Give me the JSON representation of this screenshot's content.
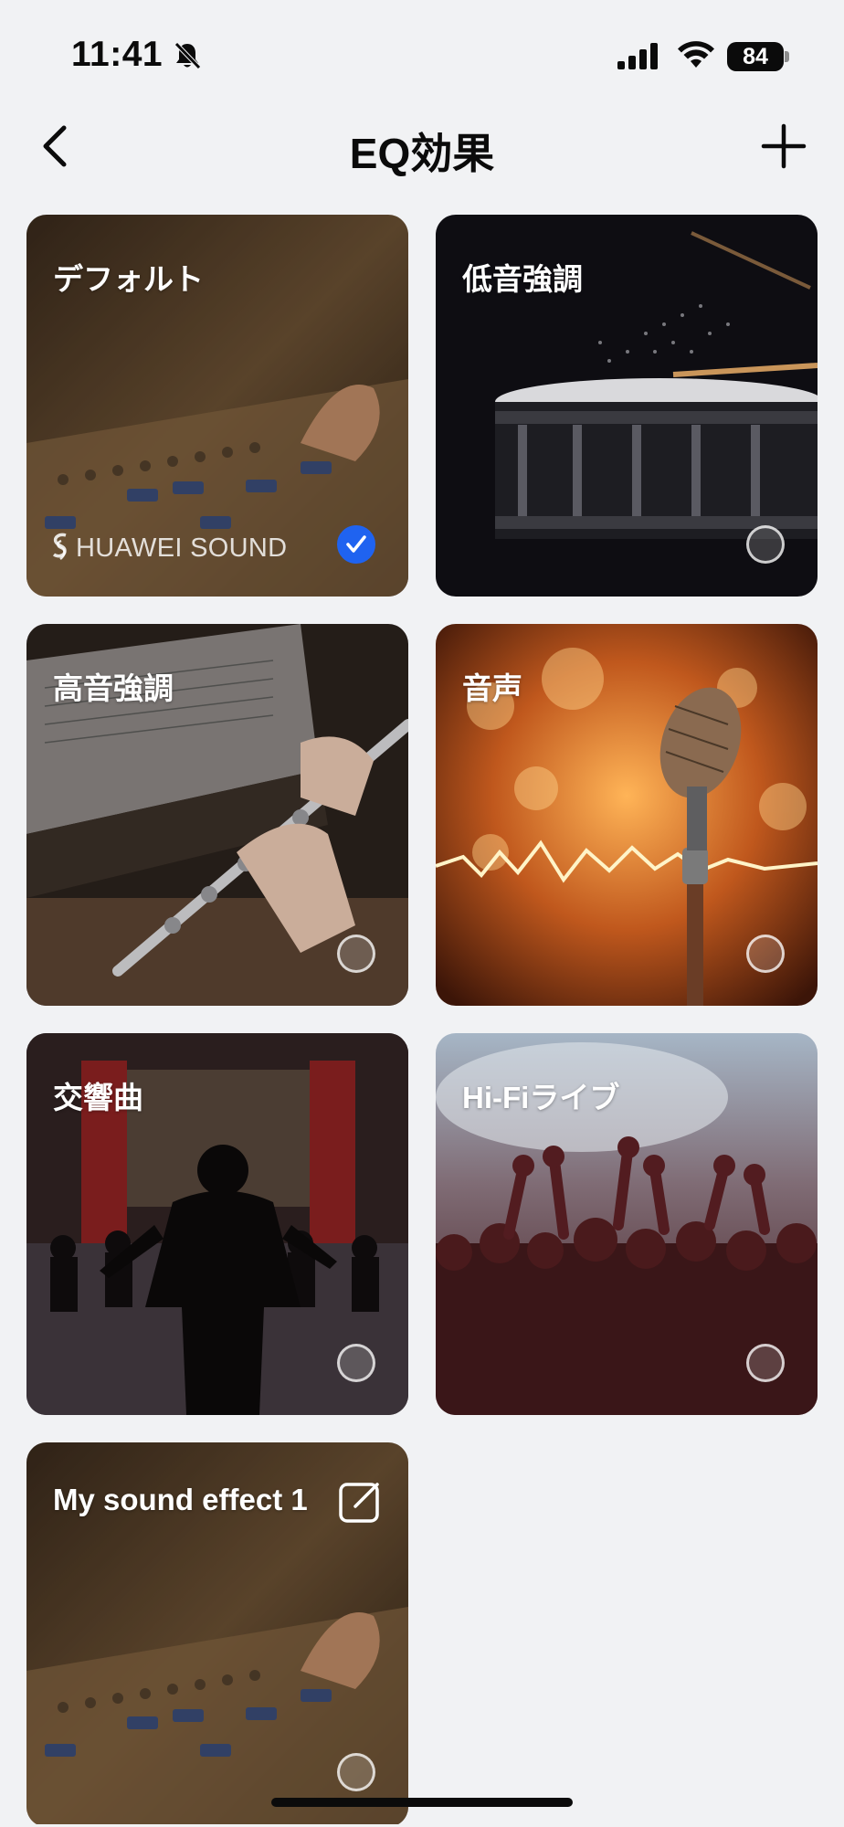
{
  "status_bar": {
    "time": "11:41",
    "battery": "84",
    "icons": [
      "bell-slash-icon",
      "signal-icon",
      "wifi-icon",
      "battery-icon"
    ]
  },
  "nav": {
    "title": "EQ効果",
    "back_icon": "chevron-left-icon",
    "add_icon": "plus-icon"
  },
  "presets": [
    {
      "label": "デフォルト",
      "selected": true,
      "scene": "mixing console"
    },
    {
      "label": "低音強調",
      "selected": false,
      "scene": "snare drum"
    },
    {
      "label": "高音強調",
      "selected": false,
      "scene": "flute"
    },
    {
      "label": "音声",
      "selected": false,
      "scene": "microphone"
    },
    {
      "label": "交響曲",
      "selected": false,
      "scene": "orchestra conductor"
    },
    {
      "label": "Hi-Fiライブ",
      "selected": false,
      "scene": "concert crowd"
    },
    {
      "label": "My sound effect 1",
      "selected": false,
      "scene": "mixing console"
    }
  ],
  "brand": "HUAWEI SOUND",
  "colors": {
    "background": "#f1f2f4",
    "accent": "#1f63f0",
    "text": "#0b0b0b"
  }
}
